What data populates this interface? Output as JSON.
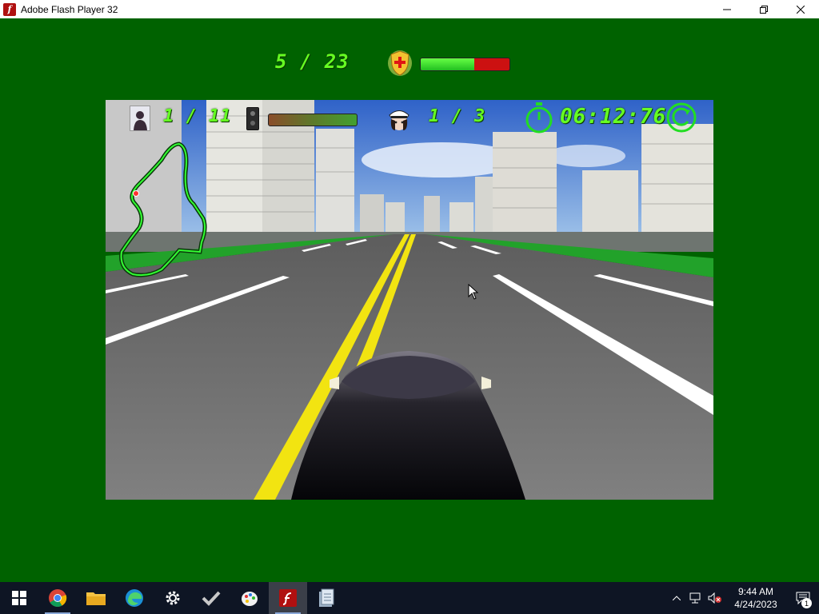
{
  "window": {
    "title": "Adobe Flash Player 32",
    "app_icon_glyph": "f"
  },
  "hud": {
    "score": "5 / 23",
    "health_fraction": 0.6,
    "passengers": "1 / 11",
    "fuel_fraction": 1.0,
    "laps": "1 / 3",
    "timer": "06:12:76"
  },
  "colors": {
    "stage_bg": "#006200",
    "hud_text": "#66ff22",
    "health_good": "#33dd22",
    "health_bad": "#cc1111"
  },
  "taskbar": {
    "items": [
      {
        "name": "start-button",
        "icon": "windows-logo-icon"
      },
      {
        "name": "chrome",
        "icon": "chrome-icon"
      },
      {
        "name": "file-explorer",
        "icon": "folder-icon"
      },
      {
        "name": "edge",
        "icon": "edge-icon"
      },
      {
        "name": "settings",
        "icon": "gear-icon"
      },
      {
        "name": "tasks",
        "icon": "checkmark-icon"
      },
      {
        "name": "paint",
        "icon": "palette-icon"
      },
      {
        "name": "flash-player",
        "icon": "flash-icon"
      },
      {
        "name": "files",
        "icon": "document-icon"
      }
    ],
    "clock_time": "9:44 AM",
    "clock_date": "4/24/2023",
    "notification_count": "1"
  }
}
